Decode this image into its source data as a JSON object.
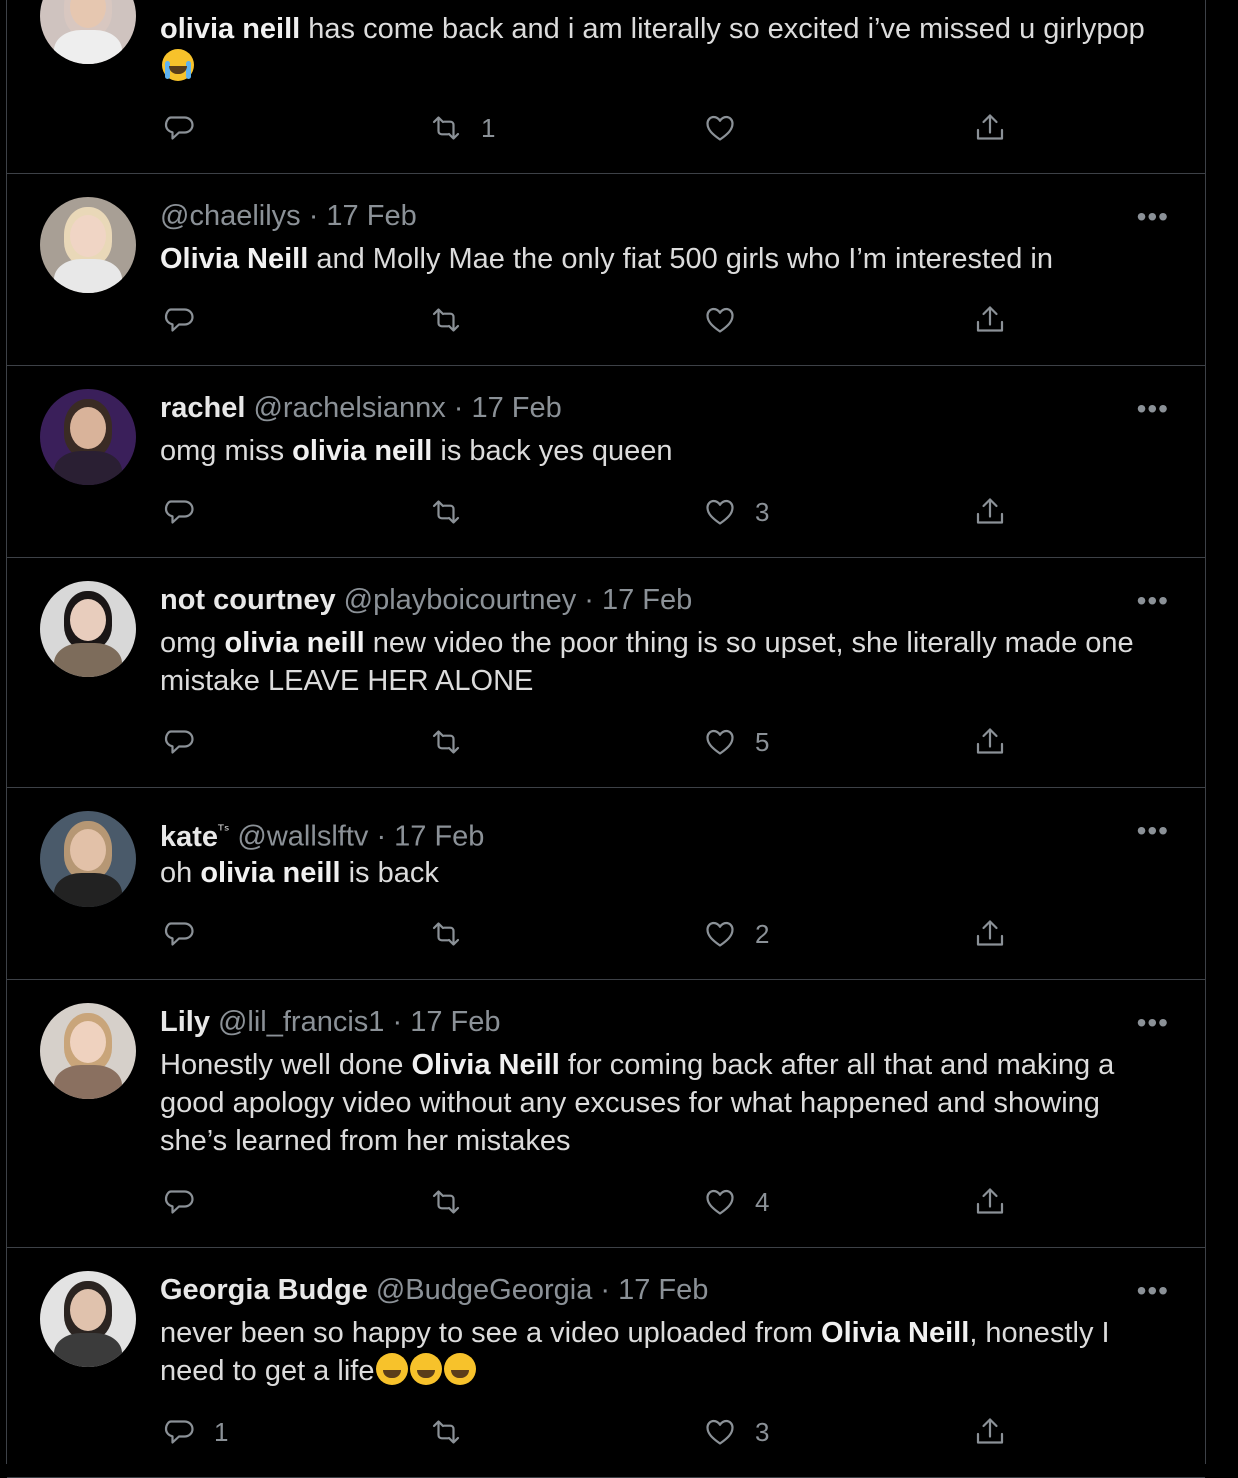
{
  "tweets": [
    {
      "name": "",
      "handle": "",
      "date": "",
      "text": [
        {
          "t": "olivia neill",
          "b": true
        },
        {
          "t": " has come back and i am literally so excited i’ve missed u girlypop ",
          "b": false
        }
      ],
      "emojis": [
        "loudly-crying-face"
      ],
      "replies": "",
      "retweets": "1",
      "likes": ""
    },
    {
      "name": "",
      "handle": "@chaelilys",
      "date": "· 17 Feb",
      "text": [
        {
          "t": "Olivia Neill",
          "b": true
        },
        {
          "t": " and Molly Mae the only fiat 500 girls who I’m interested in",
          "b": false
        }
      ],
      "emojis": [],
      "replies": "",
      "retweets": "",
      "likes": ""
    },
    {
      "name": "rachel",
      "handle": "@rachelsiannx",
      "date": "· 17 Feb",
      "text": [
        {
          "t": "omg miss ",
          "b": false
        },
        {
          "t": "olivia neill",
          "b": true
        },
        {
          "t": " is back yes queen",
          "b": false
        }
      ],
      "emojis": [],
      "replies": "",
      "retweets": "",
      "likes": "3"
    },
    {
      "name": "not courtney",
      "handle": "@playboicourtney",
      "date": "· 17 Feb",
      "text": [
        {
          "t": "omg ",
          "b": false
        },
        {
          "t": "olivia neill",
          "b": true
        },
        {
          "t": " new video the poor thing is so upset, she literally made one mistake LEAVE HER ALONE",
          "b": false
        }
      ],
      "emojis": [],
      "replies": "",
      "retweets": "",
      "likes": "5"
    },
    {
      "name": "kate",
      "name_suffix": "ᵀˢ",
      "handle": "@wallslftv",
      "date": "· 17 Feb",
      "text": [
        {
          "t": "oh ",
          "b": false
        },
        {
          "t": "olivia neill",
          "b": true
        },
        {
          "t": " is back",
          "b": false
        }
      ],
      "emojis": [],
      "replies": "",
      "retweets": "",
      "likes": "2"
    },
    {
      "name": "Lily",
      "handle": "@lil_francis1",
      "date": "· 17 Feb",
      "text": [
        {
          "t": "Honestly well done ",
          "b": false
        },
        {
          "t": "Olivia Neill",
          "b": true
        },
        {
          "t": " for coming back after all that and making a good apology video without any excuses for what happened and showing she’s learned from her mistakes",
          "b": false
        }
      ],
      "emojis": [],
      "replies": "",
      "retweets": "",
      "likes": "4"
    },
    {
      "name": "Georgia Budge",
      "handle": "@BudgeGeorgia",
      "date": "· 17 Feb",
      "text": [
        {
          "t": "never been so happy to see a video uploaded from ",
          "b": false
        },
        {
          "t": "Olivia Neill",
          "b": true
        },
        {
          "t": ", honestly I need to get a life",
          "b": false
        }
      ],
      "emojis": [
        "rolling-on-floor-laughing",
        "rolling-on-floor-laughing",
        "rolling-on-floor-laughing"
      ],
      "replies": "1",
      "retweets": "",
      "likes": "3"
    }
  ],
  "icons": {
    "reply": "reply-icon",
    "retweet": "retweet-icon",
    "like": "heart-icon",
    "share": "share-icon",
    "more": "more-options-icon"
  },
  "more_glyph": "•••",
  "colors": {
    "background": "#000000",
    "border": "#3d4147",
    "secondary_text": "#8b9197",
    "primary_text": "#dcdcdc"
  }
}
